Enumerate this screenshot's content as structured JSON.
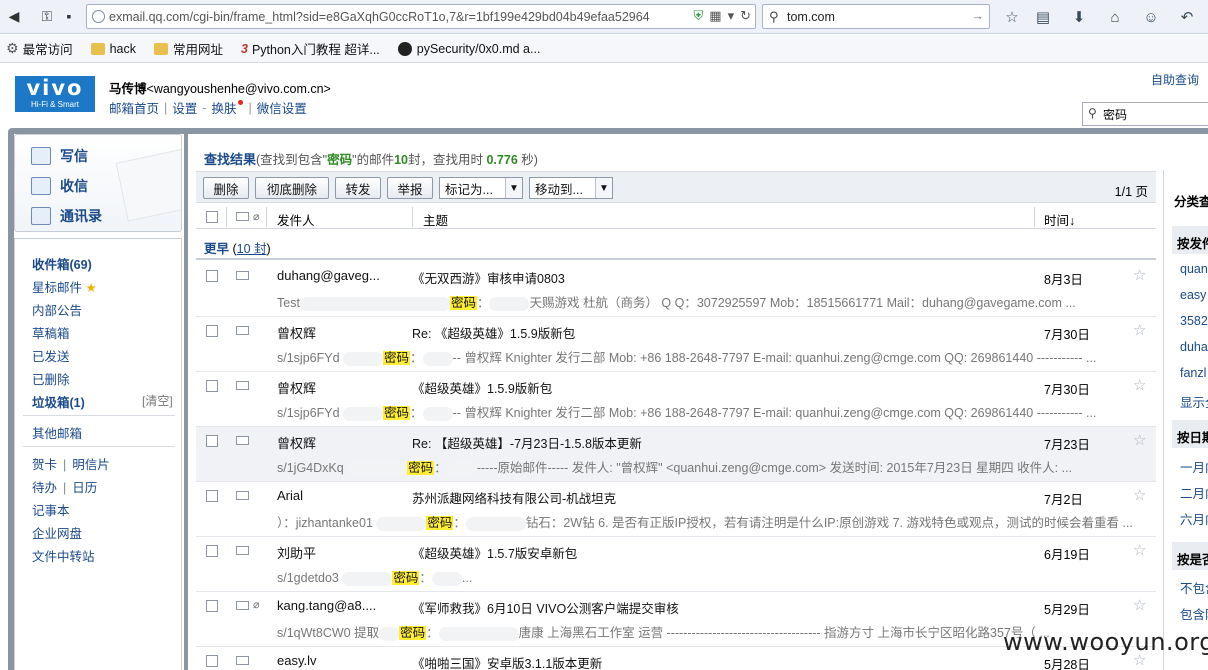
{
  "browser": {
    "url": "exmail.qq.com/cgi-bin/frame_html?sid=e8GaXqhG0ccRoT1o,7&r=1bf199e429bd04b49efaa52964",
    "search_value": "tom.com",
    "bookmarks": [
      "最常访问",
      "hack",
      "常用网址",
      "Python入门教程 超详...",
      "pySecurity/0x0.md a..."
    ]
  },
  "header": {
    "logo_big": "vivo",
    "logo_small": "Hi-Fi & Smart",
    "user_name": "马传博",
    "user_email": "<wangyoushenhe@vivo.com.cn>",
    "links": [
      "邮箱首页",
      "设置",
      "换肤",
      "微信设置"
    ],
    "self_help": "自助查询",
    "quick_search_value": "密码"
  },
  "sidebar": {
    "compose": "写信",
    "inbox_short": "收信",
    "contacts": "通讯录",
    "inbox": "收件箱(69)",
    "starred": "星标邮件",
    "internal": "内部公告",
    "drafts": "草稿箱",
    "sent": "已发送",
    "deleted": "已删除",
    "spam": "垃圾箱(1)",
    "clear": "[清空]",
    "other": "其他邮箱",
    "card": "贺卡",
    "postcard": "明信片",
    "todo": "待办",
    "calendar": "日历",
    "notes": "记事本",
    "disk": "企业网盘",
    "transfer": "文件中转站"
  },
  "results": {
    "title": "查找结果",
    "prefix": "(查找到包含\"",
    "keyword": "密码",
    "mid": "\"的邮件",
    "count": "10",
    "unit": "封，查找用时",
    "time": "0.776",
    "suffix": "秒)"
  },
  "toolbar": {
    "delete": "删除",
    "purge": "彻底删除",
    "forward": "转发",
    "report": "举报",
    "mark_as": "标记为...",
    "move_to": "移动到...",
    "pager": "1/1 页"
  },
  "columns": {
    "sender": "发件人",
    "subject": "主题",
    "time": "时间↓"
  },
  "group": {
    "label": "更早",
    "count": "10 封"
  },
  "rows": [
    {
      "sender": "duhang@gaveg...",
      "subject": "《无双西游》审核申请0803",
      "date": "8月3日",
      "snip_a": "Test",
      "snip_b": "：",
      "snip_c": "天赐游戏 杜航（商务） Q Q：3072925597 Mob：18515661771 Mail：duhang@gavegame.com ..."
    },
    {
      "sender": "曾权辉",
      "subject": "Re: 《超级英雄》1.5.9版新包",
      "date": "7月30日",
      "snip_a": "s/1sjp6FYd ",
      "snip_b": "：",
      "snip_c": "-- 曾权辉 Knighter 发行二部 Mob: +86 188-2648-7797 E-mail: quanhui.zeng@cmge.com QQ: 269861440 ----------- ..."
    },
    {
      "sender": "曾权辉",
      "subject": "《超级英雄》1.5.9版新包",
      "date": "7月30日",
      "snip_a": "s/1sjp6FYd ",
      "snip_b": "：",
      "snip_c": "-- 曾权辉 Knighter 发行二部 Mob: +86 188-2648-7797 E-mail: quanhui.zeng@cmge.com QQ: 269861440 ----------- ..."
    },
    {
      "sender": "曾权辉",
      "subject": "Re: 【超级英雄】-7月23日-1.5.8版本更新",
      "date": "7月23日",
      "snip_a": "s/1jG4DxKq ",
      "snip_b": "：",
      "snip_c": "-----原始邮件----- 发件人: \"曾权辉\" <quanhui.zeng@cmge.com> 发送时间: 2015年7月23日 星期四 收件人: ..."
    },
    {
      "sender": "Arial",
      "subject": "苏州派趣网络科技有限公司-机战坦克",
      "date": "7月2日",
      "snip_a": "）：jizhantanke01 ",
      "snip_b": "：",
      "snip_c": "钻石：2W钻 6. 是否有正版IP授权，若有请注明是什么IP:原创游戏 7. 游戏特色或观点，测试的时候会着重看 ..."
    },
    {
      "sender": "刘助平",
      "subject": "《超级英雄》1.5.7版安卓新包",
      "date": "6月19日",
      "snip_a": "s/1gdetdo3 ",
      "snip_b": "：",
      "snip_c": "..."
    },
    {
      "sender": "kang.tang@a8....",
      "subject": "《军师救我》6月10日 VIVO公测客户端提交审核",
      "date": "5月29日",
      "snip_a": "s/1qWt8CW0 提取",
      "snip_b": "：",
      "snip_c": "唐康 上海黑石工作室 运营 ------------------------------------- 指游方寸 上海市长宁区昭化路357号（ ..."
    },
    {
      "sender": "easy.lv",
      "subject": "《啪啪三国》安卓版3.1.1版本更新",
      "date": "5月28日",
      "snip_a": "",
      "snip_b": "",
      "snip_c": ""
    }
  ],
  "right_panel": {
    "title": "分类查",
    "by_sender": "按发件",
    "senders": [
      "quan",
      "easy",
      "3582",
      "duha",
      "fanzl",
      "显示全"
    ],
    "by_date": "按日期",
    "dates": [
      "一月内",
      "二月内",
      "六月内"
    ],
    "by_attach": "按是否",
    "attach": [
      "不包含",
      "包含附"
    ]
  },
  "watermark": "www.wooyun.org"
}
